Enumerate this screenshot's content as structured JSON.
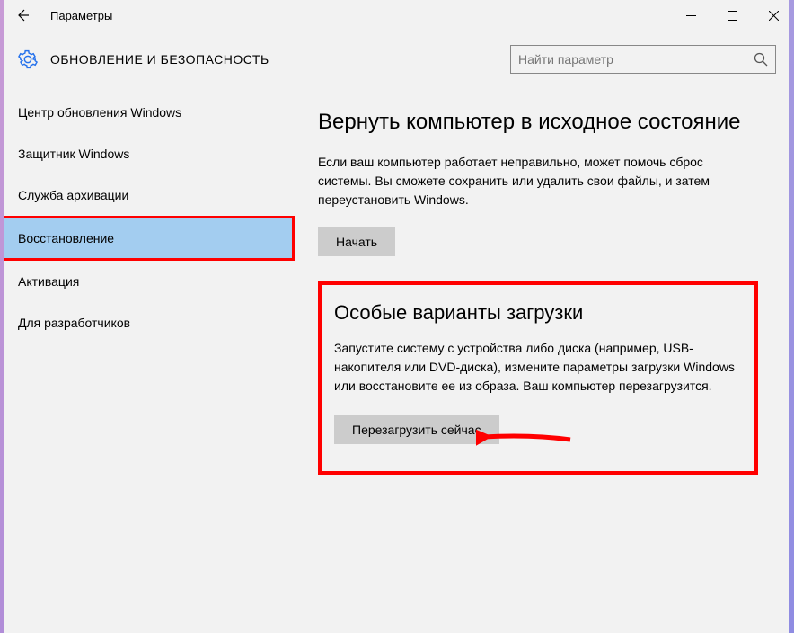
{
  "window": {
    "title": "Параметры"
  },
  "header": {
    "section_title": "ОБНОВЛЕНИЕ И БЕЗОПАСНОСТЬ",
    "search_placeholder": "Найти параметр"
  },
  "sidebar": {
    "items": [
      {
        "label": "Центр обновления Windows"
      },
      {
        "label": "Защитник Windows"
      },
      {
        "label": "Служба архивации"
      },
      {
        "label": "Восстановление"
      },
      {
        "label": "Активация"
      },
      {
        "label": "Для разработчиков"
      }
    ]
  },
  "main": {
    "reset": {
      "heading": "Вернуть компьютер в исходное состояние",
      "body": "Если ваш компьютер работает неправильно, может помочь сброс системы. Вы сможете сохранить или удалить свои файлы, и затем переустановить Windows.",
      "button": "Начать"
    },
    "advanced": {
      "heading": "Особые варианты загрузки",
      "body": "Запустите систему с устройства либо диска (например, USB-накопителя или DVD-диска), измените параметры загрузки Windows или восстановите ее из образа. Ваш компьютер перезагрузится.",
      "button": "Перезагрузить сейчас"
    }
  }
}
